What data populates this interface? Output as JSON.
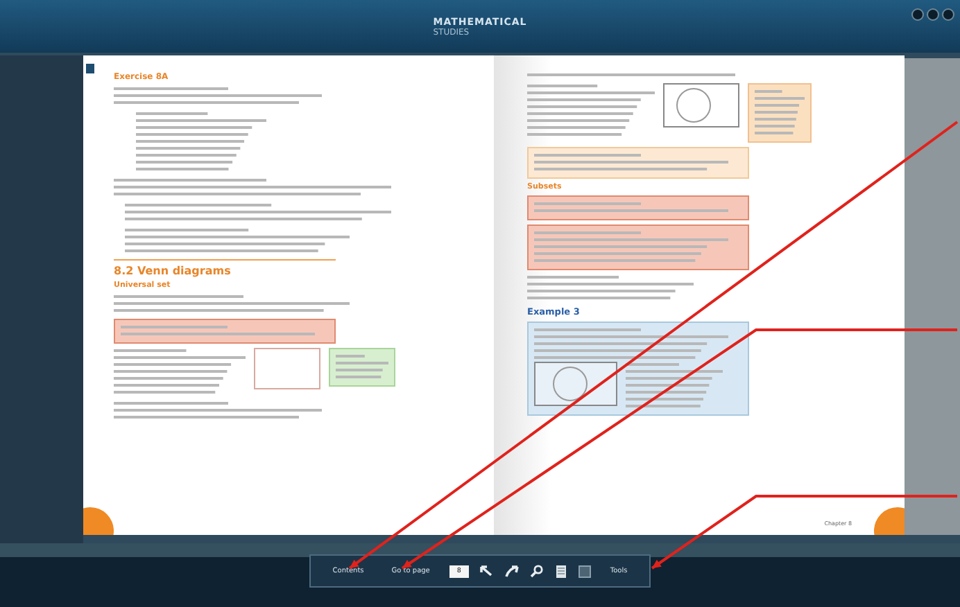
{
  "window": {
    "title": "MATHEMATICAL",
    "subtitle": "STUDIES"
  },
  "left_page": {
    "exercise_title": "Exercise 8A",
    "section_title": "8.2 Venn diagrams",
    "subsection_title": "Universal set"
  },
  "right_page": {
    "subsection_title": "Subsets",
    "example_title": "Example 3",
    "footer": "Chapter 8"
  },
  "toolbar": [
    {
      "kind": "text",
      "label": "Contents"
    },
    {
      "kind": "text",
      "label": "Go to page"
    },
    {
      "kind": "input",
      "value": "8"
    },
    {
      "kind": "back"
    },
    {
      "kind": "forward"
    },
    {
      "kind": "search"
    },
    {
      "kind": "page"
    },
    {
      "kind": "square"
    },
    {
      "kind": "text",
      "label": "Tools"
    }
  ]
}
